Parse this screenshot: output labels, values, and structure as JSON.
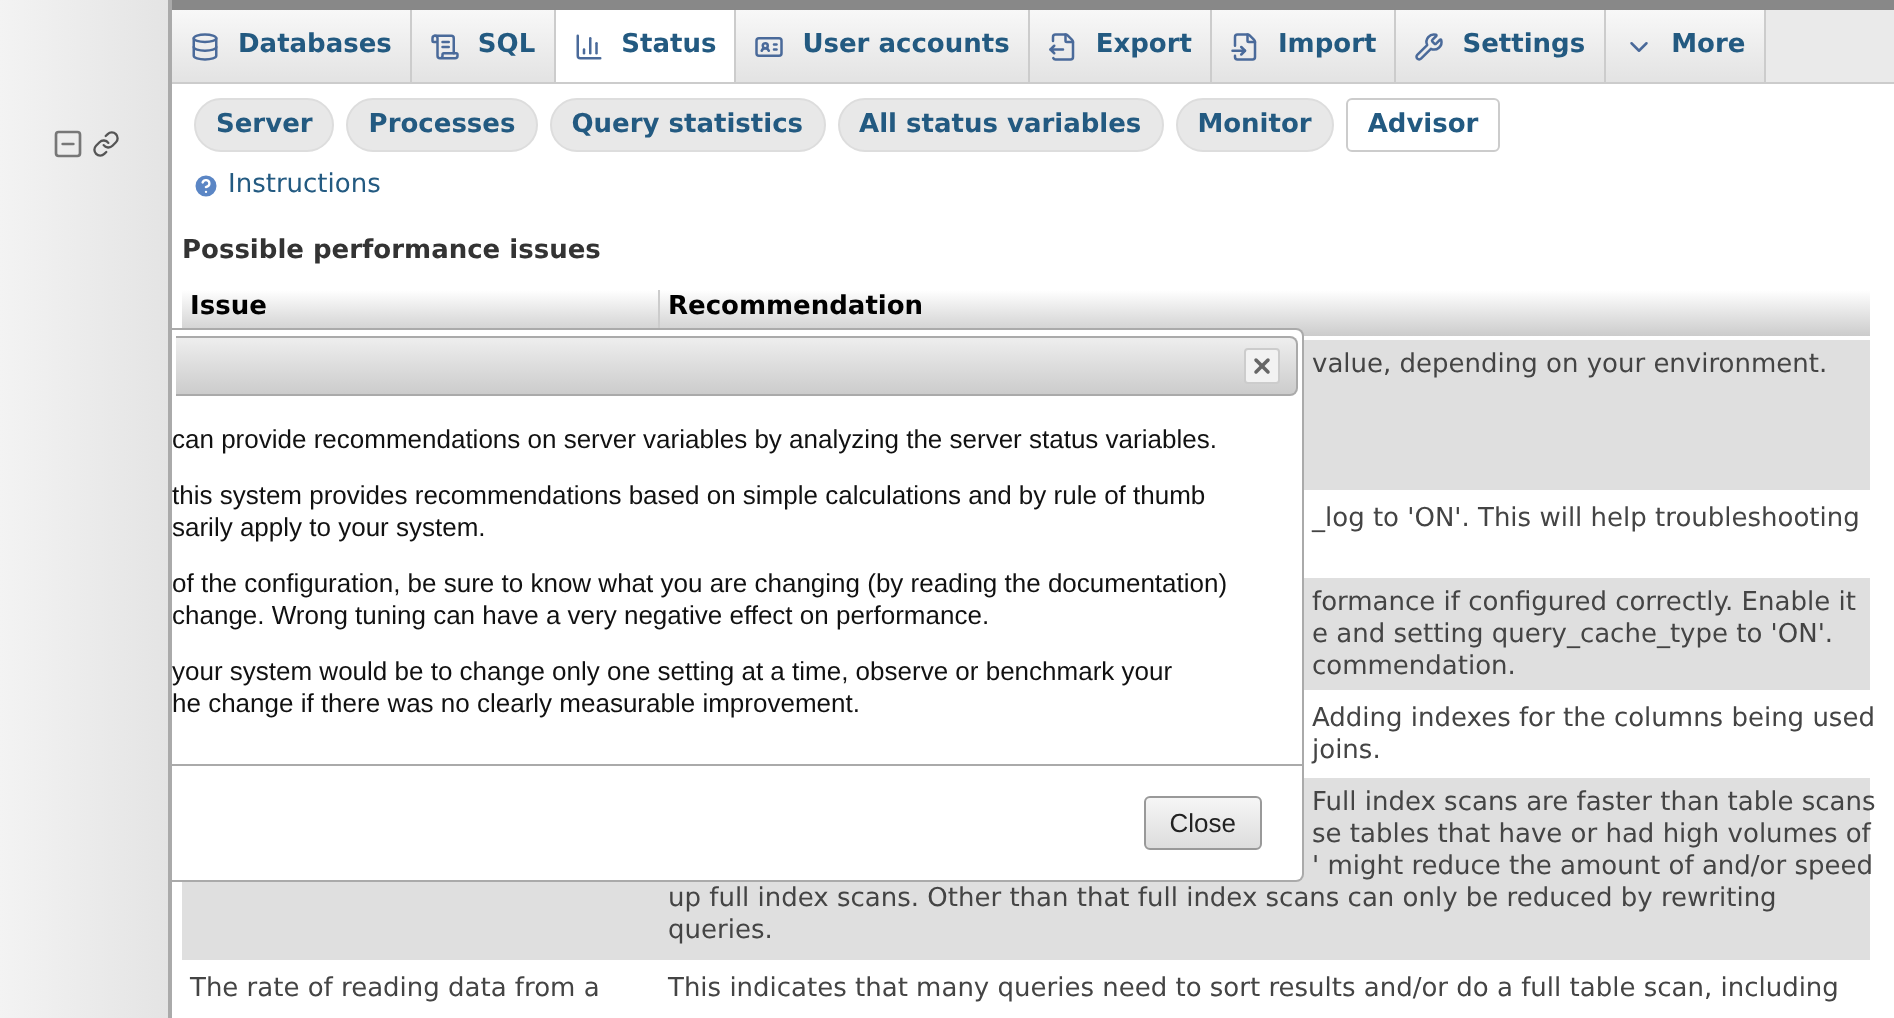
{
  "tabs": [
    {
      "label": "Databases",
      "selected": false
    },
    {
      "label": "SQL",
      "selected": false
    },
    {
      "label": "Status",
      "selected": true
    },
    {
      "label": "User accounts",
      "selected": false
    },
    {
      "label": "Export",
      "selected": false
    },
    {
      "label": "Import",
      "selected": false
    },
    {
      "label": "Settings",
      "selected": false
    },
    {
      "label": "More",
      "selected": false
    }
  ],
  "subtabs": [
    {
      "label": "Server",
      "selected": false
    },
    {
      "label": "Processes",
      "selected": false
    },
    {
      "label": "Query statistics",
      "selected": false
    },
    {
      "label": "All status variables",
      "selected": false
    },
    {
      "label": "Monitor",
      "selected": false
    },
    {
      "label": "Advisor",
      "selected": true
    }
  ],
  "instructions_link": "Instructions",
  "section_title": "Possible performance issues",
  "table": {
    "columns": [
      "Issue",
      "Recommendation"
    ],
    "rows": [
      {
        "recommendation": [
          {
            "text": "value, depending on your environment.",
            "kind": "cut"
          }
        ]
      },
      {
        "recommendation": [
          {
            "text": "_log to 'ON'. This will help troubleshooting",
            "kind": "cut"
          }
        ]
      },
      {
        "recommendation": [
          {
            "text": "formance if configured correctly. Enable it",
            "kind": "cut"
          },
          {
            "text": "e and setting query_cache_type to 'ON'.",
            "kind": "cut"
          },
          {
            "text": "commendation.",
            "kind": "cut"
          }
        ]
      },
      {
        "recommendation": [
          {
            "text": "Adding indexes for the columns being used",
            "kind": "cut"
          },
          {
            "text": "joins.",
            "kind": "cut"
          }
        ]
      },
      {
        "recommendation": [
          {
            "text": "Full index scans are faster than table scans",
            "kind": "cut"
          },
          {
            "text": "se tables that have or had high volumes of",
            "kind": "cut"
          },
          {
            "text": "' might reduce the amount of and/or speed",
            "kind": "cut"
          },
          {
            "text": "up full index scans. Other than that full index scans can only be reduced by rewriting",
            "kind": "full"
          },
          {
            "text": "queries.",
            "kind": "full"
          }
        ]
      },
      {
        "issue": [
          "The rate of reading data from a"
        ],
        "recommendation": [
          {
            "text": "This indicates that many queries need to sort results and/or do a full table scan, including",
            "kind": "full"
          }
        ]
      }
    ]
  },
  "dialog": {
    "paragraphs": [
      [
        "can provide recommendations on server variables by analyzing the server status variables."
      ],
      [
        "this system provides recommendations based on simple calculations and by rule of thumb",
        "sarily apply to your system."
      ],
      [
        "of the configuration, be sure to know what you are changing (by reading the documentation)",
        "change. Wrong tuning can have a very negative effect on performance."
      ],
      [
        "your system would be to change only one setting at a time, observe or benchmark your",
        "he change if there was no clearly measurable improvement."
      ]
    ],
    "close_button": "Close"
  }
}
